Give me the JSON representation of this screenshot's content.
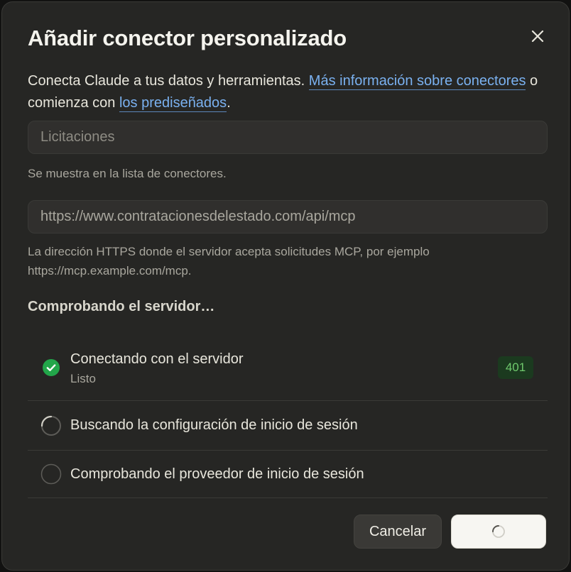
{
  "dialog": {
    "title": "Añadir conector personalizado",
    "close_icon": "close-icon",
    "intro": {
      "text_before": "Conecta Claude a tus datos y herramientas. ",
      "link_more": "Más información sobre conectores",
      "text_middle": " o comienza con ",
      "link_prebuilt": "los prediseñados",
      "text_after": "."
    },
    "name_field": {
      "placeholder": "Licitaciones",
      "hint": "Se muestra en la lista de conectores."
    },
    "url_field": {
      "value": "https://www.contratacionesdelestado.com/api/mcp",
      "hint": "La dirección HTTPS donde el servidor acepta solicitudes MCP, por ejemplo https://mcp.example.com/mcp."
    },
    "checks": {
      "heading": "Comprobando el servidor…",
      "items": [
        {
          "label": "Conectando con el servidor",
          "sub": "Listo",
          "badge": "401",
          "status": "done",
          "icon": "check-circle-icon"
        },
        {
          "label": "Buscando la configuración de inicio de sesión",
          "status": "loading",
          "icon": "spinner-icon"
        },
        {
          "label": "Comprobando el proveedor de inicio de sesión",
          "status": "pending",
          "icon": "empty-circle-icon"
        }
      ]
    },
    "buttons": {
      "cancel": "Cancelar",
      "add_icon": "spinner-icon"
    }
  },
  "colors": {
    "background": "#262624",
    "link": "#7ab1f0",
    "success": "#22a64a",
    "badge_text": "#6fc96d"
  }
}
